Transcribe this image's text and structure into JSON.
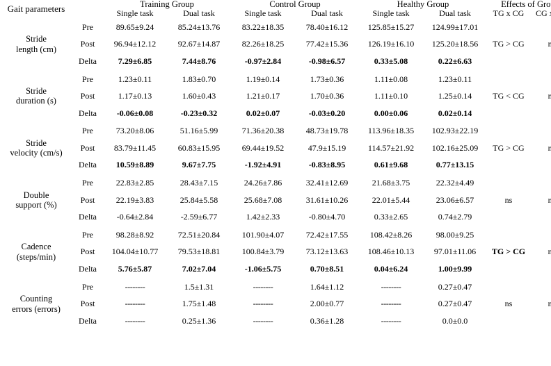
{
  "header": {
    "param_col": "Gait parameters",
    "groups": [
      {
        "label": "Training Group",
        "subs": [
          "Single task",
          "Dual task"
        ]
      },
      {
        "label": "Control Group",
        "subs": [
          "Single task",
          "Dual task"
        ]
      },
      {
        "label": "Healthy Group",
        "subs": [
          "Single task",
          "Dual task"
        ]
      }
    ],
    "effects": {
      "label": "Effects of Group",
      "subs": [
        "TG x CG",
        "CG x HG"
      ]
    }
  },
  "time_labels": {
    "pre": "Pre",
    "post": "Post",
    "delta": "Delta"
  },
  "rows": [
    {
      "parameter": "Stride\nlength (cm)",
      "parameter_line1": "Stride",
      "parameter_line2": "length (cm)",
      "pre": [
        "89.65±9.24",
        "85.24±13.76",
        "83.22±18.35",
        "78.40±16.12",
        "125.85±15.27",
        "124.99±17.01"
      ],
      "post": [
        "96.94±12.12",
        "92.67±14.87",
        "82.26±18.25",
        "77.42±15.36",
        "126.19±16.10",
        "125.20±18.56"
      ],
      "delta": [
        "7.29±6.85",
        "7.44±8.76",
        "-0.97±2.84",
        "-0.98±6.57",
        "0.33±5.08",
        "0.22±6.63"
      ],
      "delta_bold": true,
      "effect_tg_cg": "TG > CG",
      "effect_tg_cg_bold": false,
      "effect_cg_hg": "ns",
      "effect_cg_hg_bold": false
    },
    {
      "parameter": "Stride\nduration (s)",
      "parameter_line1": "Stride",
      "parameter_line2": "duration (s)",
      "pre": [
        "1.23±0.11",
        "1.83±0.70",
        "1.19±0.14",
        "1.73±0.36",
        "1.11±0.08",
        "1.23±0.11"
      ],
      "post": [
        "1.17±0.13",
        "1.60±0.43",
        "1.21±0.17",
        "1.70±0.36",
        "1.11±0.10",
        "1.25±0.14"
      ],
      "delta": [
        "-0.06±0.08",
        "-0.23±0.32",
        "0.02±0.07",
        "-0.03±0.20",
        "0.00±0.06",
        "0.02±0.14"
      ],
      "delta_bold": true,
      "effect_tg_cg": "TG < CG",
      "effect_tg_cg_bold": false,
      "effect_cg_hg": "ns",
      "effect_cg_hg_bold": false
    },
    {
      "parameter": "Stride\nvelocity (cm/s)",
      "parameter_line1": "Stride",
      "parameter_line2": "velocity (cm/s)",
      "pre": [
        "73.20±8.06",
        "51.16±5.99",
        "71.36±20.38",
        "48.73±19.78",
        "113.96±18.35",
        "102.93±22.19"
      ],
      "post": [
        "83.79±11.45",
        "60.83±15.95",
        "69.44±19.52",
        "47.9±15.19",
        "114.57±21.92",
        "102.16±25.09"
      ],
      "delta": [
        "10.59±8.89",
        "9.67±7.75",
        "-1.92±4.91",
        "-0.83±8.95",
        "0.61±9.68",
        "0.77±13.15"
      ],
      "delta_bold": true,
      "effect_tg_cg": "TG > CG",
      "effect_tg_cg_bold": false,
      "effect_cg_hg": "ns",
      "effect_cg_hg_bold": false
    },
    {
      "parameter": "Double\nsupport (%)",
      "parameter_line1": "Double",
      "parameter_line2": "support (%)",
      "pre": [
        "22.83±2.85",
        "28.43±7.15",
        "24.26±7.86",
        "32.41±12.69",
        "21.68±3.75",
        "22.32±4.49"
      ],
      "post": [
        "22.19±3.83",
        "25.84±5.58",
        "25.68±7.08",
        "31.61±10.26",
        "22.01±5.44",
        "23.06±6.57"
      ],
      "delta": [
        "-0.64±2.84",
        "-2.59±6.77",
        "1.42±2.33",
        "-0.80±4.70",
        "0.33±2.65",
        "0.74±2.79"
      ],
      "delta_bold": false,
      "effect_tg_cg": "ns",
      "effect_tg_cg_bold": false,
      "effect_cg_hg": "ns",
      "effect_cg_hg_bold": false
    },
    {
      "parameter": "Cadence\n(steps/min)",
      "parameter_line1": "Cadence",
      "parameter_line2": "(steps/min)",
      "pre": [
        "98.28±8.92",
        "72.51±20.84",
        "101.90±4.07",
        "72.42±17.55",
        "108.42±8.26",
        "98.00±9.25"
      ],
      "post": [
        "104.04±10.77",
        "79.53±18.81",
        "100.84±3.79",
        "73.12±13.63",
        "108.46±10.13",
        "97.01±11.06"
      ],
      "delta": [
        "5.76±5.87",
        "7.02±7.04",
        "-1.06±5.75",
        "0.70±8.51",
        "0.04±6.24",
        "1.00±9.99"
      ],
      "delta_bold": true,
      "effect_tg_cg": "TG > CG",
      "effect_tg_cg_bold": true,
      "effect_cg_hg": "ns",
      "effect_cg_hg_bold": false
    },
    {
      "parameter": "Counting\nerrors (errors)",
      "parameter_line1": "Counting",
      "parameter_line2": "errors (errors)",
      "pre": [
        "--------",
        "1.5±1.31",
        "--------",
        "1.64±1.12",
        "--------",
        "0.27±0.47"
      ],
      "post": [
        "--------",
        "1.75±1.48",
        "--------",
        "2.00±0.77",
        "--------",
        "0.27±0.47"
      ],
      "delta": [
        "--------",
        "0.25±1.36",
        "--------",
        "0.36±1.28",
        "--------",
        "0.0±0.0"
      ],
      "delta_bold": false,
      "effect_tg_cg": "ns",
      "effect_tg_cg_bold": false,
      "effect_cg_hg": "ns",
      "effect_cg_hg_bold": false
    }
  ]
}
